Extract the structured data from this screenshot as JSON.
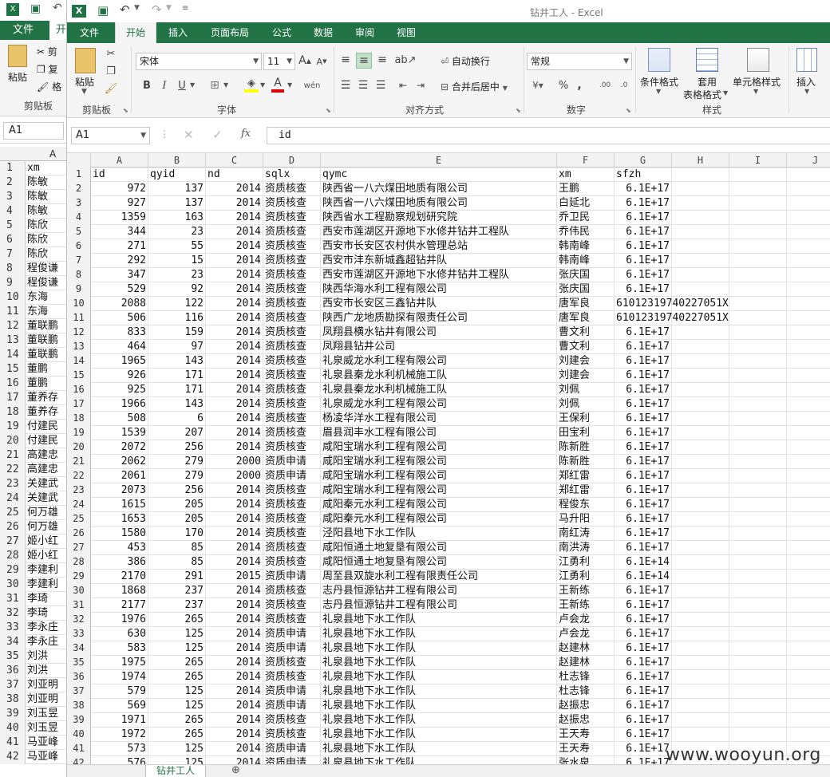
{
  "back": {
    "file_tab": "文件",
    "home_tab_partial": "开",
    "paste_label": "粘贴",
    "cut_partial": "剪",
    "copy_partial": "复",
    "format_partial": "格",
    "clipboard_label": "剪贴板",
    "name_box": "A1",
    "col_a": "A",
    "rows": [
      {
        "n": "1",
        "v": "xm"
      },
      {
        "n": "2",
        "v": "陈敏"
      },
      {
        "n": "3",
        "v": "陈敏"
      },
      {
        "n": "4",
        "v": "陈敏"
      },
      {
        "n": "5",
        "v": "陈欣"
      },
      {
        "n": "6",
        "v": "陈欣"
      },
      {
        "n": "7",
        "v": "陈欣"
      },
      {
        "n": "8",
        "v": "程俊谦"
      },
      {
        "n": "9",
        "v": "程俊谦"
      },
      {
        "n": "10",
        "v": "东海"
      },
      {
        "n": "11",
        "v": "东海"
      },
      {
        "n": "12",
        "v": "董联鹏"
      },
      {
        "n": "13",
        "v": "董联鹏"
      },
      {
        "n": "14",
        "v": "董联鹏"
      },
      {
        "n": "15",
        "v": "董鹏"
      },
      {
        "n": "16",
        "v": "董鹏"
      },
      {
        "n": "17",
        "v": "董养存"
      },
      {
        "n": "18",
        "v": "董养存"
      },
      {
        "n": "19",
        "v": "付建民"
      },
      {
        "n": "20",
        "v": "付建民"
      },
      {
        "n": "21",
        "v": "高建忠"
      },
      {
        "n": "22",
        "v": "高建忠"
      },
      {
        "n": "23",
        "v": "关建武"
      },
      {
        "n": "24",
        "v": "关建武"
      },
      {
        "n": "25",
        "v": "何万雄"
      },
      {
        "n": "26",
        "v": "何万雄"
      },
      {
        "n": "27",
        "v": "姬小红"
      },
      {
        "n": "28",
        "v": "姬小红"
      },
      {
        "n": "29",
        "v": "李建利"
      },
      {
        "n": "30",
        "v": "李建利"
      },
      {
        "n": "31",
        "v": "李琦"
      },
      {
        "n": "32",
        "v": "李琦"
      },
      {
        "n": "33",
        "v": "李永庄"
      },
      {
        "n": "34",
        "v": "李永庄"
      },
      {
        "n": "35",
        "v": "刘洪"
      },
      {
        "n": "36",
        "v": "刘洪"
      },
      {
        "n": "37",
        "v": "刘亚明"
      },
      {
        "n": "38",
        "v": "刘亚明"
      },
      {
        "n": "39",
        "v": "刘玉昱"
      },
      {
        "n": "40",
        "v": "刘玉昱"
      },
      {
        "n": "41",
        "v": "马亚峰"
      },
      {
        "n": "42",
        "v": "马亚峰"
      }
    ]
  },
  "window": {
    "title": "钻井工人 - Excel",
    "tabs": [
      "文件",
      "开始",
      "插入",
      "页面布局",
      "公式",
      "数据",
      "审阅",
      "视图"
    ]
  },
  "ribbon": {
    "paste": "粘贴",
    "clipboard": "剪贴板",
    "font_name": "宋体",
    "font_size": "11",
    "font_group": "字体",
    "wrap_text": "自动换行",
    "merge_center": "合并后居中",
    "align_group": "对齐方式",
    "number_format": "常规",
    "number_group": "数字",
    "cond_format": "条件格式",
    "table_format_1": "套用",
    "table_format_2": "表格格式",
    "cell_styles": "单元格样式",
    "styles_group": "样式",
    "insert": "插入",
    "bold": "B",
    "italic": "I",
    "underline": "U",
    "grow_font": "A",
    "shrink_font": "A",
    "percent": "%",
    "comma": ","
  },
  "formula_bar": {
    "name_box": "A1",
    "fx": "fx",
    "value": "id"
  },
  "columns": [
    "A",
    "B",
    "C",
    "D",
    "E",
    "F",
    "G",
    "H",
    "I",
    "J"
  ],
  "header_row": [
    "id",
    "qyid",
    "nd",
    "sqlx",
    "qymc",
    "xm",
    "sfzh"
  ],
  "rows": [
    [
      "972",
      "137",
      "2014",
      "资质核查",
      "陕西省一八六煤田地质有限公司",
      "王鹏",
      "6.1E+17"
    ],
    [
      "927",
      "137",
      "2014",
      "资质核查",
      "陕西省一八六煤田地质有限公司",
      "白延北",
      "6.1E+17"
    ],
    [
      "1359",
      "163",
      "2014",
      "资质核查",
      "陕西省水工程勘察规划研究院",
      "乔卫民",
      "6.1E+17"
    ],
    [
      "344",
      "23",
      "2014",
      "资质核查",
      "西安市莲湖区开源地下水修井钻井工程队",
      "乔伟民",
      "6.1E+17"
    ],
    [
      "271",
      "55",
      "2014",
      "资质核查",
      "西安市长安区农村供水管理总站",
      "韩南峰",
      "6.1E+17"
    ],
    [
      "292",
      "15",
      "2014",
      "资质核查",
      "西安市沣东新城鑫超钻井队",
      "韩南峰",
      "6.1E+17"
    ],
    [
      "347",
      "23",
      "2014",
      "资质核查",
      "西安市莲湖区开源地下水修井钻井工程队",
      "张庆国",
      "6.1E+17"
    ],
    [
      "529",
      "92",
      "2014",
      "资质核查",
      "陕西华海水利工程有限公司",
      "张庆国",
      "6.1E+17"
    ],
    [
      "2088",
      "122",
      "2014",
      "资质核查",
      "西安市长安区三鑫钻井队",
      "唐军良",
      "61012319740227051X"
    ],
    [
      "506",
      "116",
      "2014",
      "资质核查",
      "陕西广龙地质勘探有限责任公司",
      "唐军良",
      "61012319740227051X"
    ],
    [
      "833",
      "159",
      "2014",
      "资质核查",
      "凤翔县横水钻井有限公司",
      "曹文利",
      "6.1E+17"
    ],
    [
      "464",
      "97",
      "2014",
      "资质核查",
      "凤翔县钻井公司",
      "曹文利",
      "6.1E+17"
    ],
    [
      "1965",
      "143",
      "2014",
      "资质核查",
      "礼泉威龙水利工程有限公司",
      "刘建会",
      "6.1E+17"
    ],
    [
      "926",
      "171",
      "2014",
      "资质核查",
      "礼泉县秦龙水利机械施工队",
      "刘建会",
      "6.1E+17"
    ],
    [
      "925",
      "171",
      "2014",
      "资质核查",
      "礼泉县秦龙水利机械施工队",
      "刘佩",
      "6.1E+17"
    ],
    [
      "1966",
      "143",
      "2014",
      "资质核查",
      "礼泉威龙水利工程有限公司",
      "刘佩",
      "6.1E+17"
    ],
    [
      "508",
      "6",
      "2014",
      "资质核查",
      "杨凌华洋水工程有限公司",
      "王保利",
      "6.1E+17"
    ],
    [
      "1539",
      "207",
      "2014",
      "资质核查",
      "眉县润丰水工程有限公司",
      "田宝利",
      "6.1E+17"
    ],
    [
      "2072",
      "256",
      "2014",
      "资质核查",
      "咸阳宝瑞水利工程有限公司",
      "陈新胜",
      "6.1E+17"
    ],
    [
      "2062",
      "279",
      "2000",
      "资质申请",
      "咸阳宝瑞水利工程有限公司",
      "陈新胜",
      "6.1E+17"
    ],
    [
      "2061",
      "279",
      "2000",
      "资质申请",
      "咸阳宝瑞水利工程有限公司",
      "郑红雷",
      "6.1E+17"
    ],
    [
      "2073",
      "256",
      "2014",
      "资质核查",
      "咸阳宝瑞水利工程有限公司",
      "郑红雷",
      "6.1E+17"
    ],
    [
      "1615",
      "205",
      "2014",
      "资质核查",
      "咸阳秦元水利工程有限公司",
      "程俊东",
      "6.1E+17"
    ],
    [
      "1653",
      "205",
      "2014",
      "资质核查",
      "咸阳秦元水利工程有限公司",
      "马升阳",
      "6.1E+17"
    ],
    [
      "1580",
      "170",
      "2014",
      "资质核查",
      "泾阳县地下水工作队",
      "南红涛",
      "6.1E+17"
    ],
    [
      "453",
      "85",
      "2014",
      "资质核查",
      "咸阳恒通土地复垦有限公司",
      "南洪涛",
      "6.1E+17"
    ],
    [
      "386",
      "85",
      "2014",
      "资质核查",
      "咸阳恒通土地复垦有限公司",
      "江勇利",
      "6.1E+14"
    ],
    [
      "2170",
      "291",
      "2015",
      "资质申请",
      "周至县双旋水利工程有限责任公司",
      "江勇利",
      "6.1E+14"
    ],
    [
      "1868",
      "237",
      "2014",
      "资质核查",
      "志丹县恒源钻井工程有限公司",
      "王新练",
      "6.1E+17"
    ],
    [
      "2177",
      "237",
      "2014",
      "资质核查",
      "志丹县恒源钻井工程有限公司",
      "王新练",
      "6.1E+17"
    ],
    [
      "1976",
      "265",
      "2014",
      "资质核查",
      "礼泉县地下水工作队",
      "卢会龙",
      "6.1E+17"
    ],
    [
      "630",
      "125",
      "2014",
      "资质申请",
      "礼泉县地下水工作队",
      "卢会龙",
      "6.1E+17"
    ],
    [
      "583",
      "125",
      "2014",
      "资质申请",
      "礼泉县地下水工作队",
      "赵建林",
      "6.1E+17"
    ],
    [
      "1975",
      "265",
      "2014",
      "资质核查",
      "礼泉县地下水工作队",
      "赵建林",
      "6.1E+17"
    ],
    [
      "1974",
      "265",
      "2014",
      "资质核查",
      "礼泉县地下水工作队",
      "杜志锋",
      "6.1E+17"
    ],
    [
      "579",
      "125",
      "2014",
      "资质申请",
      "礼泉县地下水工作队",
      "杜志锋",
      "6.1E+17"
    ],
    [
      "569",
      "125",
      "2014",
      "资质申请",
      "礼泉县地下水工作队",
      "赵振忠",
      "6.1E+17"
    ],
    [
      "1971",
      "265",
      "2014",
      "资质核查",
      "礼泉县地下水工作队",
      "赵振忠",
      "6.1E+17"
    ],
    [
      "1972",
      "265",
      "2014",
      "资质核查",
      "礼泉县地下水工作队",
      "王天寿",
      "6.1E+17"
    ],
    [
      "573",
      "125",
      "2014",
      "资质申请",
      "礼泉县地下水工作队",
      "王天寿",
      "6.1E+17"
    ],
    [
      "576",
      "125",
      "2014",
      "资质申请",
      "礼泉县地下水工作队",
      "张水泉",
      "6.1E+17"
    ]
  ],
  "sheet_tab": "钻井工人",
  "watermark": "www.wooyun.org"
}
